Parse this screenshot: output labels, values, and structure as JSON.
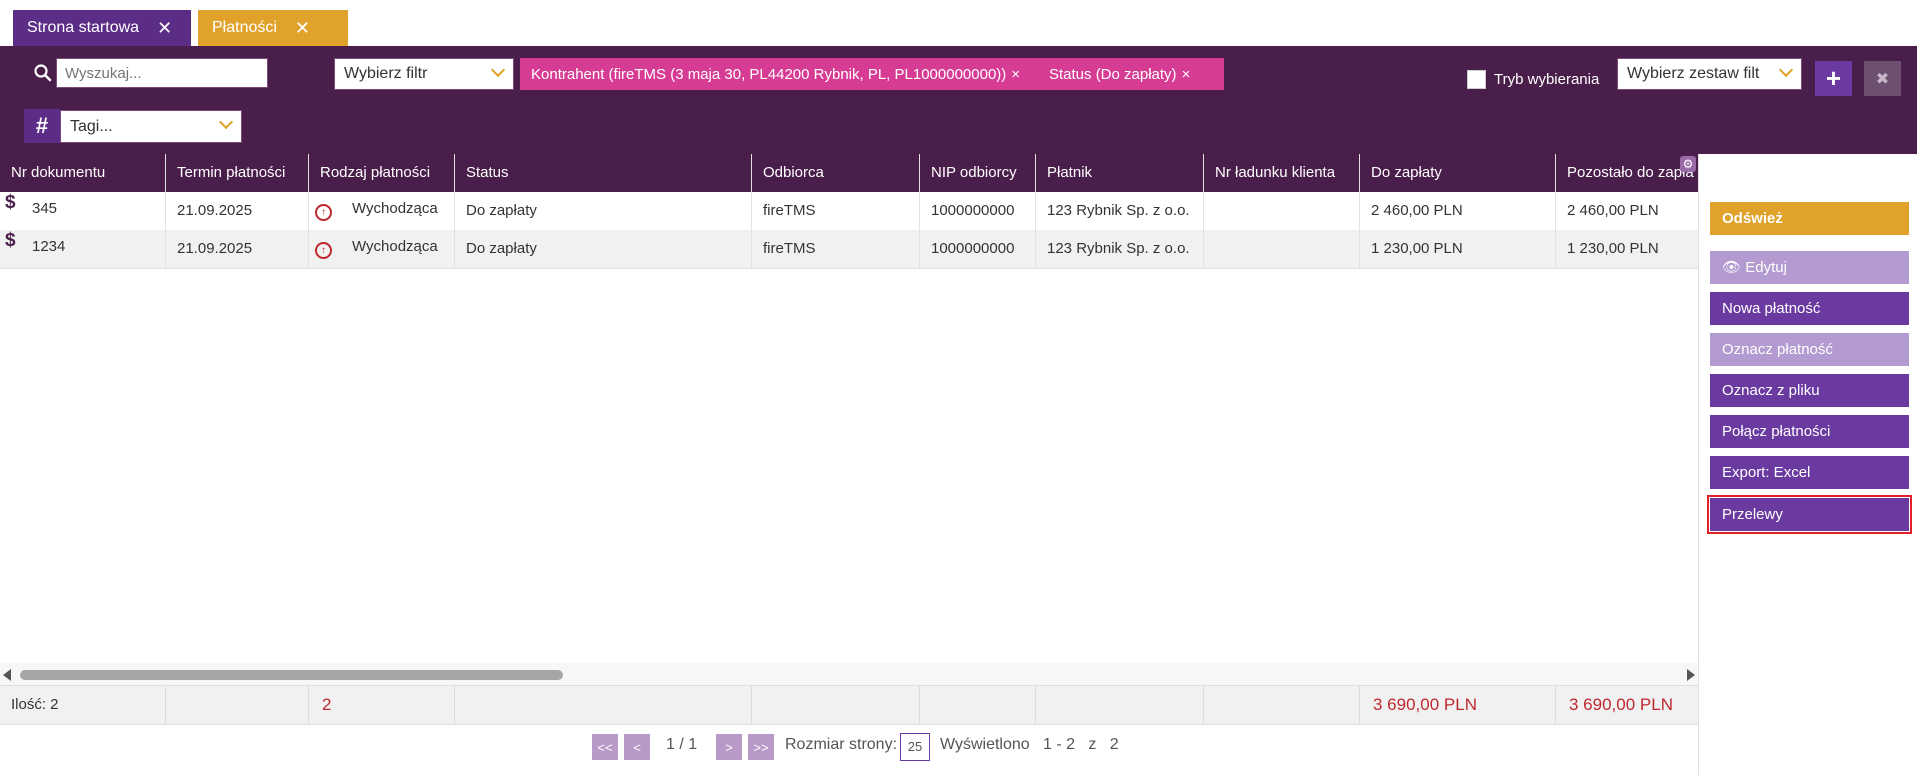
{
  "tabs": [
    {
      "label": "Strona startowa",
      "color": "#5c2d87"
    },
    {
      "label": "Płatności",
      "color": "#e0a22a"
    }
  ],
  "toolbar": {
    "search_placeholder": "Wyszukaj...",
    "filter_select": "Wybierz filtr",
    "chips": [
      "Kontrahent (fireTMS (3 maja 30, PL44200 Rybnik, PL, PL1000000000))",
      "Status (Do zapłaty)"
    ],
    "chip_close": "×",
    "selection_mode_label": "Tryb wybierania",
    "filter_set_select": "Wybierz zestaw filt",
    "tags_placeholder": "Tagi...",
    "plus_label": "+",
    "delete_label": "✖"
  },
  "columns": [
    "Nr dokumentu",
    "Termin płatności",
    "Rodzaj płatności",
    "Status",
    "Odbiorca",
    "NIP odbiorcy",
    "Płatnik",
    "Nr ładunku klienta",
    "Do zapłaty",
    "Pozostało do zapła ..."
  ],
  "rows": [
    {
      "nr": "345",
      "termin": "21.09.2025",
      "rodzaj": "Wychodząca",
      "status": "Do zapłaty",
      "odbiorca": "fireTMS",
      "nip": "1000000000",
      "platnik": "123 Rybnik Sp. z o.o.",
      "ladunek": "",
      "do_zaplaty": "2 460,00 PLN",
      "pozostalo": "2 460,00 PLN"
    },
    {
      "nr": "1234",
      "termin": "21.09.2025",
      "rodzaj": "Wychodząca",
      "status": "Do zapłaty",
      "odbiorca": "fireTMS",
      "nip": "1000000000",
      "platnik": "123 Rybnik Sp. z o.o.",
      "ladunek": "",
      "do_zaplaty": "1 230,00 PLN",
      "pozostalo": "1 230,00 PLN"
    }
  ],
  "footer": {
    "count_label": "Ilość: 2",
    "count_value": "2",
    "sum_do_zaplaty": "3 690,00 PLN",
    "sum_pozostalo": "3 690,00 PLN"
  },
  "pager": {
    "first": "<<",
    "prev": "<",
    "page": "1  /  1",
    "next": ">",
    "last": ">>",
    "page_size_label": "Rozmiar strony:",
    "page_size": "25",
    "shown": "Wyświetlono   1 - 2   z   2"
  },
  "side_buttons": {
    "refresh": "Odśwież",
    "edit": "Edytuj",
    "new_payment": "Nowa płatność",
    "mark_payment": "Oznacz płatność",
    "mark_from_file": "Oznacz z pliku",
    "merge_payments": "Połącz płatności",
    "export_excel": "Export: Excel",
    "transfers": "Przelewy"
  },
  "colors": {
    "header_bg": "#4a1e4a",
    "accent_purple": "#6a3aa0",
    "accent_orange": "#e0a22a",
    "chip_pink": "#d63c93",
    "highlight_red": "#e0202a"
  }
}
